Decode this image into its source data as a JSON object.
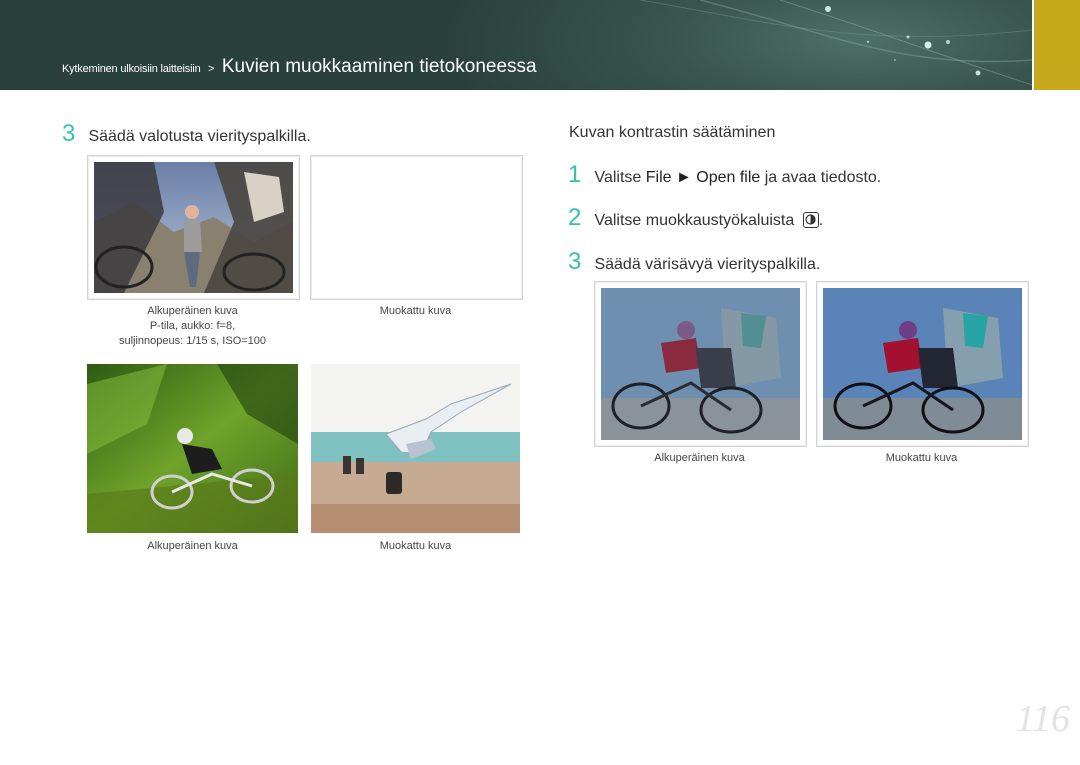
{
  "header": {
    "breadcrumb_small": "Kytkeminen ulkoisiin laitteisiin",
    "separator": ">",
    "title": "Kuvien muokkaaminen tietokoneessa"
  },
  "left": {
    "step3": {
      "num": "3",
      "text": "Säädä valotusta vierityspalkilla."
    },
    "exposure_pair": {
      "original_caption": "Alkuperäinen kuva",
      "original_detail_1": "P-tila, aukko: f=8,",
      "original_detail_2": "suljinnopeus: 1/15 s, ISO=100",
      "modified_caption": "Muokattu kuva"
    },
    "second_pair": {
      "original_caption": "Alkuperäinen kuva",
      "modified_caption": "Muokattu kuva"
    }
  },
  "right": {
    "section_title": "Kuvan kontrastin säätäminen",
    "step1": {
      "num": "1",
      "prefix": "Valitse ",
      "menu": "File ► Open file",
      "suffix": "  ja avaa tiedosto."
    },
    "step2": {
      "num": "2",
      "text": "Valitse muokkaustyökaluista",
      "end": "."
    },
    "step3": {
      "num": "3",
      "text": "Säädä värisävyä vierityspalkilla."
    },
    "pair": {
      "original_caption": "Alkuperäinen kuva",
      "modified_caption": "Muokattu kuva"
    }
  },
  "page_number": "116",
  "colors": {
    "accent": "#33c3a9",
    "banner": "#2f4a45",
    "gold": "#c9a91c"
  },
  "icons": [
    "contrast-tool-icon"
  ]
}
